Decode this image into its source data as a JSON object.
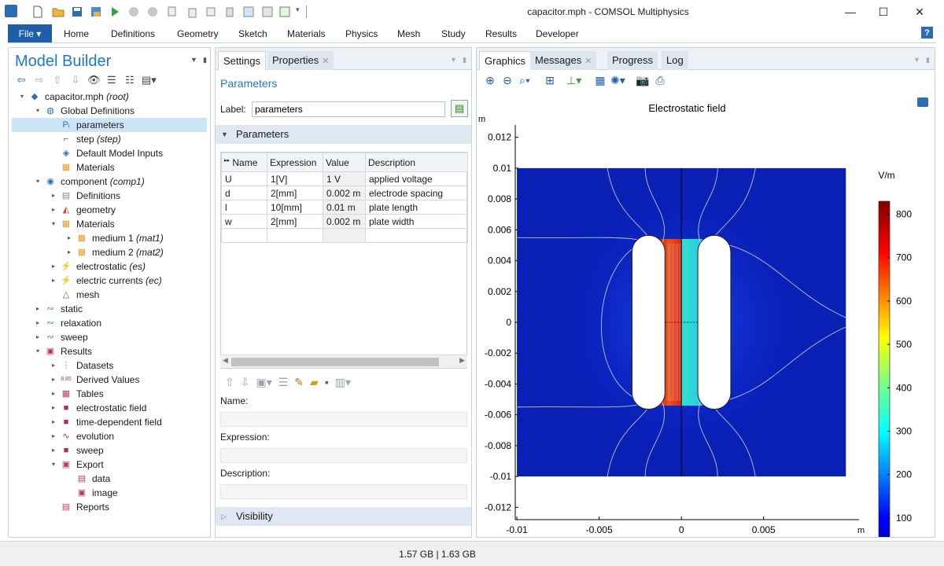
{
  "window": {
    "title": "capacitor.mph - COMSOL Multiphysics"
  },
  "ribbon": {
    "file_label": "File ▾",
    "tabs": [
      "Home",
      "Definitions",
      "Geometry",
      "Sketch",
      "Materials",
      "Physics",
      "Mesh",
      "Study",
      "Results",
      "Developer"
    ],
    "help": "?"
  },
  "model_builder": {
    "title": "Model Builder",
    "tree": [
      {
        "label": "capacitor.mph",
        "tag": "(root)",
        "icon": "model-icon"
      },
      {
        "label": "Global Definitions",
        "tag": "",
        "icon": "globe-icon"
      },
      {
        "label": "parameters",
        "tag": "",
        "icon": "parameters-icon"
      },
      {
        "label": "step",
        "tag": "(step)",
        "icon": "step-function-icon"
      },
      {
        "label": "Default Model Inputs",
        "tag": "",
        "icon": "model-inputs-icon"
      },
      {
        "label": "Materials",
        "tag": "",
        "icon": "materials-icon"
      },
      {
        "label": "component",
        "tag": "(comp1)",
        "icon": "component-icon"
      },
      {
        "label": "Definitions",
        "tag": "",
        "icon": "definitions-icon"
      },
      {
        "label": "geometry",
        "tag": "",
        "icon": "geometry-icon"
      },
      {
        "label": "Materials",
        "tag": "",
        "icon": "materials-icon"
      },
      {
        "label": "medium 1",
        "tag": "(mat1)",
        "icon": "material-icon"
      },
      {
        "label": "medium 2",
        "tag": "(mat2)",
        "icon": "material-icon"
      },
      {
        "label": "electrostatic",
        "tag": "(es)",
        "icon": "electrostatics-icon"
      },
      {
        "label": "electric currents",
        "tag": "(ec)",
        "icon": "electric-currents-icon"
      },
      {
        "label": "mesh",
        "tag": "",
        "icon": "mesh-icon"
      },
      {
        "label": "static",
        "tag": "",
        "icon": "study-icon"
      },
      {
        "label": "relaxation",
        "tag": "",
        "icon": "study-icon"
      },
      {
        "label": "sweep",
        "tag": "",
        "icon": "study-icon"
      },
      {
        "label": "Results",
        "tag": "",
        "icon": "results-icon"
      },
      {
        "label": "Datasets",
        "tag": "",
        "icon": "datasets-icon"
      },
      {
        "label": "Derived Values",
        "tag": "",
        "icon": "derived-values-icon"
      },
      {
        "label": "Tables",
        "tag": "",
        "icon": "tables-icon"
      },
      {
        "label": "electrostatic field",
        "tag": "",
        "icon": "plot-group-icon"
      },
      {
        "label": "time-dependent field",
        "tag": "",
        "icon": "plot-group-icon"
      },
      {
        "label": "evolution",
        "tag": "",
        "icon": "1d-plot-icon"
      },
      {
        "label": "sweep",
        "tag": "",
        "icon": "plot-group-icon"
      },
      {
        "label": "Export",
        "tag": "",
        "icon": "export-icon"
      },
      {
        "label": "data",
        "tag": "",
        "icon": "export-data-icon"
      },
      {
        "label": "image",
        "tag": "",
        "icon": "export-image-icon"
      },
      {
        "label": "Reports",
        "tag": "",
        "icon": "reports-icon"
      }
    ]
  },
  "settings": {
    "tabs": [
      "Settings",
      "Properties"
    ],
    "heading": "Parameters",
    "label_field": {
      "label": "Label:",
      "value": "parameters"
    },
    "section_parameters": "Parameters",
    "table": {
      "columns": [
        "Name",
        "Expression",
        "Value",
        "Description"
      ],
      "rows": [
        [
          "U",
          "1[V]",
          "1 V",
          "applied voltage"
        ],
        [
          "d",
          "2[mm]",
          "0.002 m",
          "electrode spacing"
        ],
        [
          "l",
          "10[mm]",
          "0.01 m",
          "plate length"
        ],
        [
          "w",
          "2[mm]",
          "0.002 m",
          "plate width"
        ],
        [
          "",
          "",
          "",
          ""
        ]
      ]
    },
    "name_label": "Name:",
    "expression_label": "Expression:",
    "description_label": "Description:",
    "section_visibility": "Visibility"
  },
  "graphics": {
    "tabs": [
      "Graphics",
      "Messages",
      "Progress",
      "Log"
    ]
  },
  "chart_data": {
    "type": "heatmap",
    "title": "Electrostatic field",
    "xlabel": "m",
    "ylabel": "m",
    "x_ticks": [
      "-0.01",
      "-0.005",
      "0",
      "0.005"
    ],
    "y_ticks": [
      "0.012",
      "0.01",
      "0.008",
      "0.006",
      "0.004",
      "0.002",
      "0",
      "-0.002",
      "-0.004",
      "-0.006",
      "-0.008",
      "-0.01",
      "-0.012"
    ],
    "xlim": [
      -0.0101,
      0.0108
    ],
    "ylim": [
      -0.0128,
      0.0128
    ],
    "domain": {
      "x": [
        -0.01,
        0.01
      ],
      "y": [
        -0.01,
        0.01
      ]
    },
    "electrodes": [
      {
        "x": [
          -0.003,
          -0.001
        ],
        "y": [
          -0.005,
          0.005
        ]
      },
      {
        "x": [
          0.001,
          0.003
        ],
        "y": [
          -0.005,
          0.005
        ]
      }
    ],
    "colorbar": {
      "unit": "V/m",
      "range": [
        0,
        830
      ],
      "ticks": [
        "800",
        "700",
        "600",
        "500",
        "400",
        "300",
        "200",
        "100"
      ],
      "tick_values": [
        800,
        700,
        600,
        500,
        400,
        300,
        200,
        100
      ]
    }
  },
  "status": {
    "memory": "1.57 GB | 1.63 GB"
  }
}
